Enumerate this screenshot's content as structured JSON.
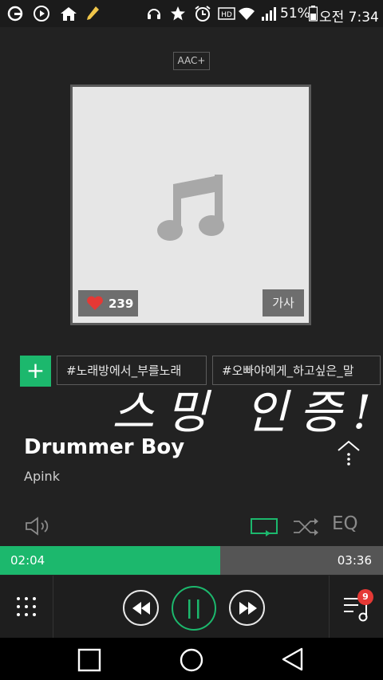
{
  "status_bar": {
    "battery_percent": "51%",
    "time": "오전 7:34",
    "icons": [
      "g-app-icon",
      "play-circle-icon",
      "home-icon",
      "pencil-icon",
      "headset-icon",
      "star-icon",
      "alarm-icon",
      "hd-icon",
      "wifi-icon",
      "signal-icon",
      "battery-icon"
    ]
  },
  "player": {
    "codec": "AAC+",
    "like_count": "239",
    "lyrics_label": "가사",
    "tags": [
      "#노래방에서_부를노래",
      "#오빠야에게_하고싶은_말"
    ],
    "overlay_text": "스밍 인증!",
    "song_title": "Drummer Boy",
    "artist": "Apink",
    "eq_label": "EQ",
    "elapsed": "02:04",
    "duration": "03:36",
    "progress_fraction": 0.574,
    "playlist_count": "9"
  },
  "colors": {
    "accent": "#1cb86d",
    "background": "#222222",
    "like": "#e53935"
  }
}
